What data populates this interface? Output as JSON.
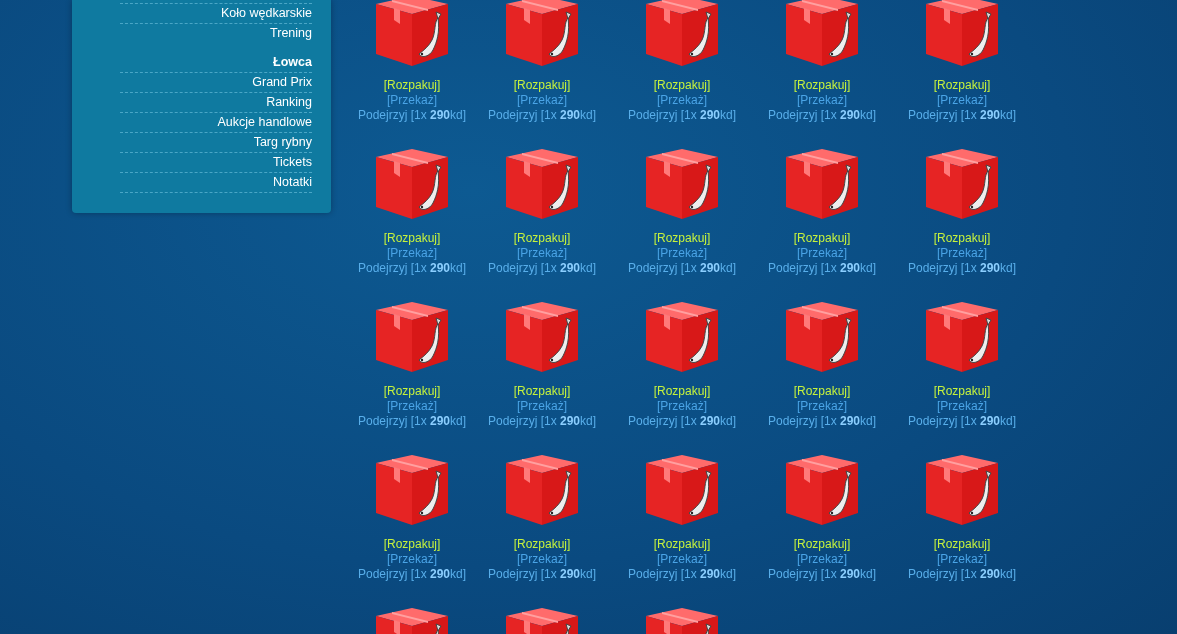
{
  "sidebar": {
    "items": [
      {
        "kind": "link",
        "label": "Koło wędkarskie"
      },
      {
        "kind": "link",
        "label": "Trening"
      },
      {
        "kind": "heading",
        "label": "Łowca"
      },
      {
        "kind": "link",
        "label": "Grand Prix"
      },
      {
        "kind": "link",
        "label": "Ranking"
      },
      {
        "kind": "link",
        "label": "Aukcje handlowe"
      },
      {
        "kind": "link",
        "label": "Targ rybny"
      },
      {
        "kind": "link",
        "label": "Tickets"
      },
      {
        "kind": "link",
        "label": "Notatki"
      }
    ]
  },
  "packages": [
    {
      "kind": "package",
      "unpack": "[Rozpakuj]",
      "transfer": "[Przekaż]",
      "preview": "Podejrzyj [1x **290**kd]"
    },
    {
      "kind": "package",
      "unpack": "[Rozpakuj]",
      "transfer": "[Przekaż]",
      "preview": "Podejrzyj [1x **290**kd]"
    },
    {
      "kind": "package",
      "unpack": "[Rozpakuj]",
      "transfer": "[Przekaż]",
      "preview": "Podejrzyj [1x **290**kd]"
    },
    {
      "kind": "package",
      "unpack": "[Rozpakuj]",
      "transfer": "[Przekaż]",
      "preview": "Podejrzyj [1x **290**kd]"
    },
    {
      "kind": "package",
      "unpack": "[Rozpakuj]",
      "transfer": "[Przekaż]",
      "preview": "Podejrzyj [1x **290**kd]"
    },
    {
      "kind": "package",
      "unpack": "[Rozpakuj]",
      "transfer": "[Przekaż]",
      "preview": "Podejrzyj [1x **290**kd]"
    },
    {
      "kind": "package",
      "unpack": "[Rozpakuj]",
      "transfer": "[Przekaż]",
      "preview": "Podejrzyj [1x **290**kd]"
    },
    {
      "kind": "package",
      "unpack": "[Rozpakuj]",
      "transfer": "[Przekaż]",
      "preview": "Podejrzyj [1x **290**kd]"
    },
    {
      "kind": "package",
      "unpack": "[Rozpakuj]",
      "transfer": "[Przekaż]",
      "preview": "Podejrzyj [1x **290**kd]"
    },
    {
      "kind": "package",
      "unpack": "[Rozpakuj]",
      "transfer": "[Przekaż]",
      "preview": "Podejrzyj [1x **290**kd]"
    },
    {
      "kind": "package",
      "unpack": "[Rozpakuj]",
      "transfer": "[Przekaż]",
      "preview": "Podejrzyj [1x **290**kd]"
    },
    {
      "kind": "package",
      "unpack": "[Rozpakuj]",
      "transfer": "[Przekaż]",
      "preview": "Podejrzyj [1x **290**kd]"
    },
    {
      "kind": "package",
      "unpack": "[Rozpakuj]",
      "transfer": "[Przekaż]",
      "preview": "Podejrzyj [1x **290**kd]"
    },
    {
      "kind": "package",
      "unpack": "[Rozpakuj]",
      "transfer": "[Przekaż]",
      "preview": "Podejrzyj [1x **290**kd]"
    },
    {
      "kind": "package",
      "unpack": "[Rozpakuj]",
      "transfer": "[Przekaż]",
      "preview": "Podejrzyj [1x **290**kd]"
    },
    {
      "kind": "package",
      "unpack": "[Rozpakuj]",
      "transfer": "[Przekaż]",
      "preview": "Podejrzyj [1x **290**kd]"
    },
    {
      "kind": "package",
      "unpack": "[Rozpakuj]",
      "transfer": "[Przekaż]",
      "preview": "Podejrzyj [1x **290**kd]"
    },
    {
      "kind": "package",
      "unpack": "[Rozpakuj]",
      "transfer": "[Przekaż]",
      "preview": "Podejrzyj [1x **290**kd]"
    },
    {
      "kind": "package",
      "unpack": "[Rozpakuj]",
      "transfer": "[Przekaż]",
      "preview": "Podejrzyj [1x **290**kd]"
    },
    {
      "kind": "package",
      "unpack": "[Rozpakuj]",
      "transfer": "[Przekaż]",
      "preview": "Podejrzyj [1x **290**kd]"
    },
    {
      "kind": "package"
    },
    {
      "kind": "package"
    },
    {
      "kind": "package"
    }
  ]
}
